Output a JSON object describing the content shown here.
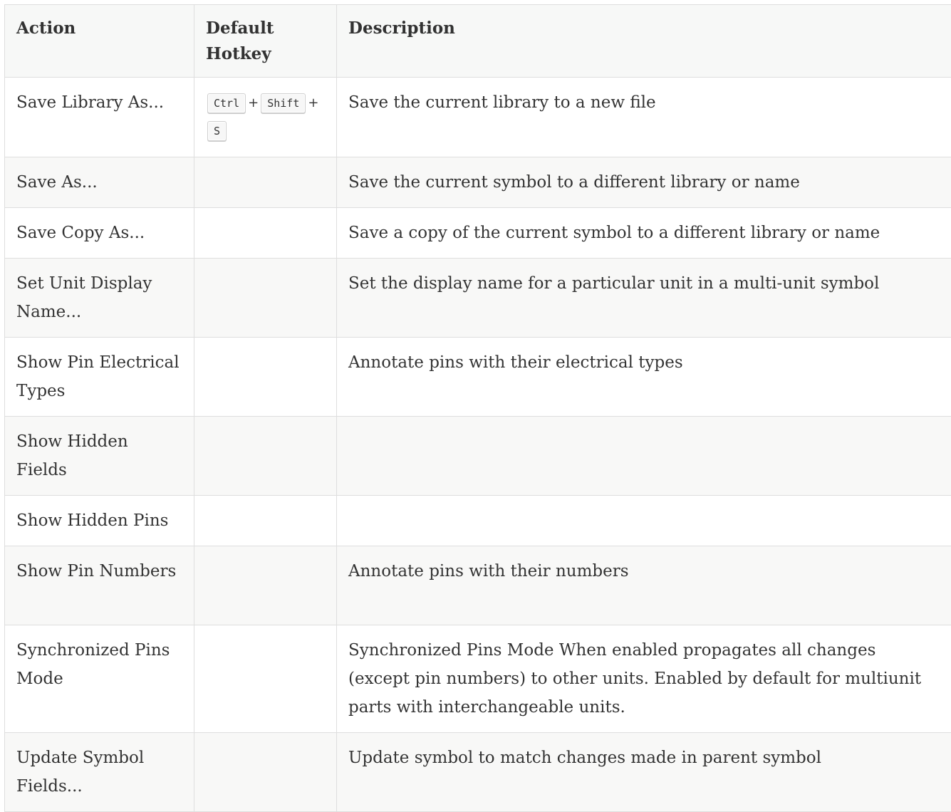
{
  "table": {
    "headers": {
      "action": "Action",
      "hotkey": "Default Hotkey",
      "description": "Description"
    },
    "rows": [
      {
        "action": "Save Library As...",
        "keys": [
          "Ctrl",
          "Shift",
          "S"
        ],
        "description": "Save the current library to a new file"
      },
      {
        "action": "Save As...",
        "keys": [],
        "description": "Save the current symbol to a different library or name"
      },
      {
        "action": "Save Copy As...",
        "keys": [],
        "description": "Save a copy of the current symbol to a different library or name"
      },
      {
        "action": "Set Unit Display Name...",
        "keys": [],
        "description": "Set the display name for a particular unit in a multi-unit symbol"
      },
      {
        "action": "Show Pin Electrical Types",
        "keys": [],
        "description": "Annotate pins with their electrical types"
      },
      {
        "action": "Show Hidden Fields",
        "keys": [],
        "description": ""
      },
      {
        "action": "Show Hidden Pins",
        "keys": [],
        "description": ""
      },
      {
        "action": "Show Pin Numbers",
        "keys": [],
        "description": "Annotate pins with their numbers"
      },
      {
        "action": "Synchronized Pins Mode",
        "keys": [],
        "description": "Synchronized Pins Mode When enabled propagates all changes (except pin numbers) to other units. Enabled by default for multiunit parts with interchangeable units."
      },
      {
        "action": "Update Symbol Fields...",
        "keys": [],
        "description": "Update symbol to match changes made in parent symbol"
      }
    ]
  }
}
